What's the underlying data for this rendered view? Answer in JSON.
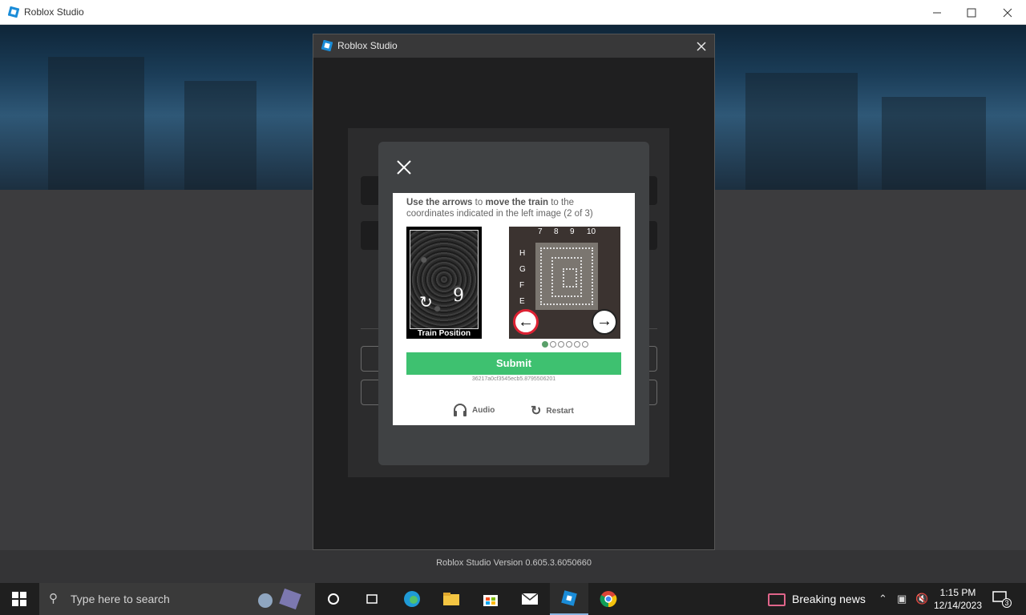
{
  "window": {
    "title": "Roblox Studio"
  },
  "dialog": {
    "title": "Roblox Studio",
    "version": "Roblox Studio Version 0.605.3.6050660"
  },
  "captcha": {
    "instruction_bold1": "Use the arrows",
    "instruction_mid1": " to ",
    "instruction_bold2": "move the train",
    "instruction_rest": " to the coordinates indicated in the left image (2 of 3)",
    "left_caption": "Train Position",
    "left_number": "9",
    "columns": [
      "7",
      "8",
      "9",
      "10"
    ],
    "rows": [
      "H",
      "G",
      "F",
      "E"
    ],
    "dots_total": 6,
    "dots_active": 1,
    "submit_label": "Submit",
    "session_id": "36217a0cf3545ecb5.8795506201",
    "audio_label": "Audio",
    "restart_label": "Restart"
  },
  "taskbar": {
    "search_placeholder": "Type here to search",
    "news_label": "Breaking news",
    "time": "1:15 PM",
    "date": "12/14/2023",
    "notifications": "3"
  },
  "colors": {
    "submit": "#3ec170",
    "accent_red": "#d23",
    "taskbar": "#1f1f1f"
  }
}
